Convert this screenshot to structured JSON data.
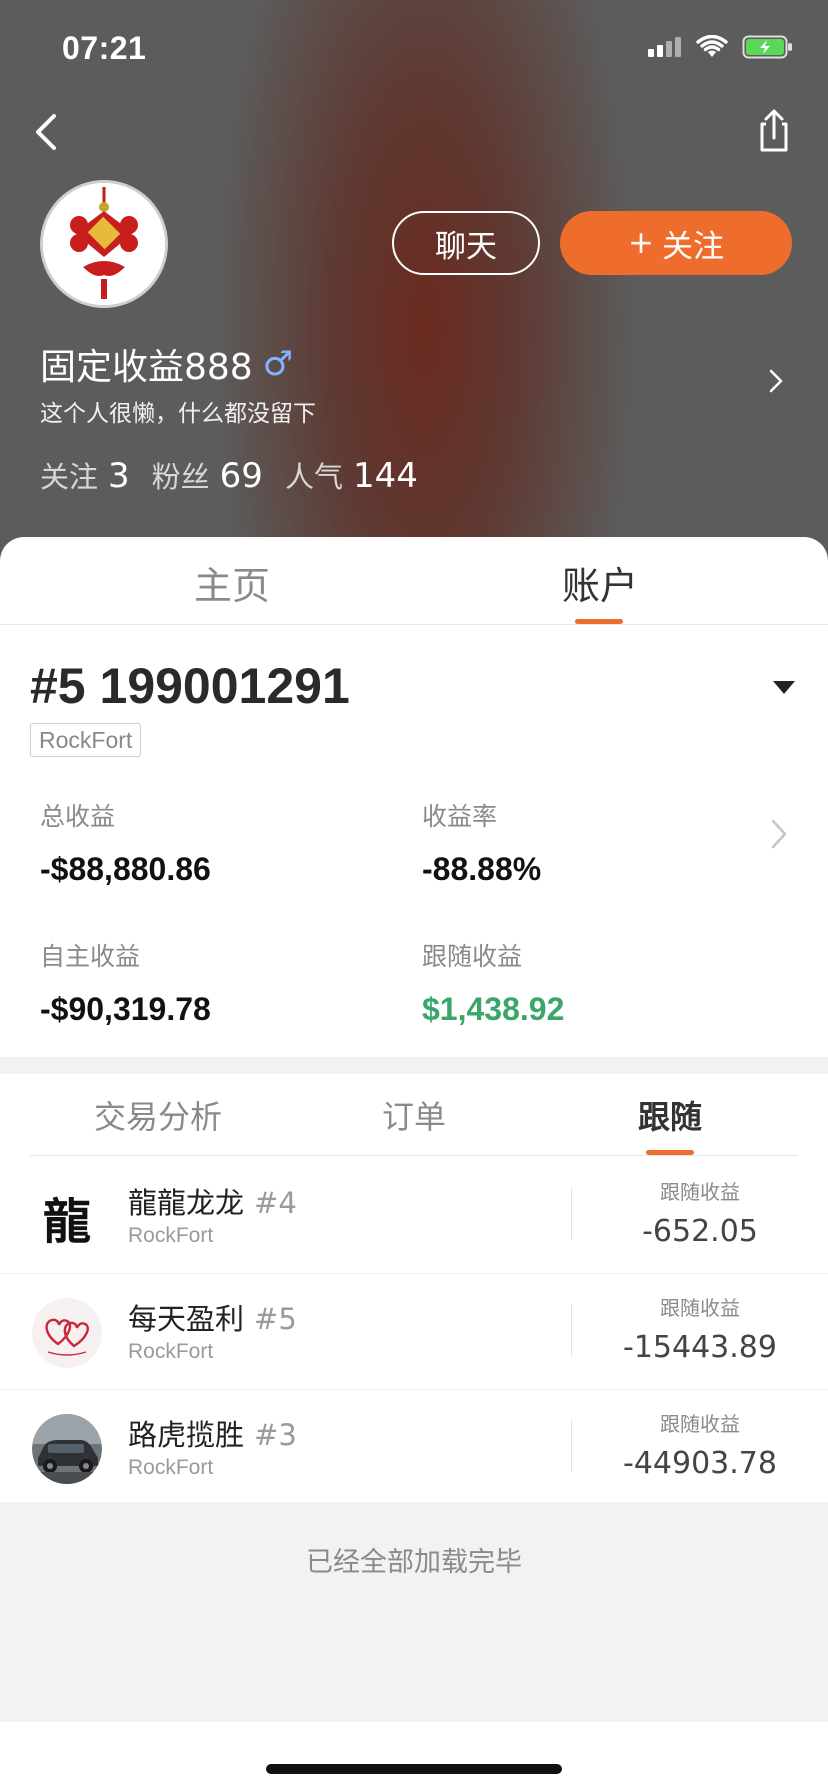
{
  "status_bar": {
    "time": "07:21"
  },
  "profile": {
    "chat_label": "聊天",
    "follow_label": "关注",
    "follow_plus": "+",
    "username": "固定收益888",
    "gender_symbol": "♂",
    "bio": "这个人很懒，什么都没留下",
    "stats": [
      {
        "label": "关注",
        "value": "3"
      },
      {
        "label": "粉丝",
        "value": "69"
      },
      {
        "label": "人气",
        "value": "144"
      }
    ]
  },
  "top_tabs": [
    {
      "label": "主页",
      "active": false
    },
    {
      "label": "账户",
      "active": true
    }
  ],
  "account": {
    "number": "#5 199001291",
    "broker": "RockFort",
    "metrics": [
      {
        "label": "总收益",
        "value": "-$88,880.86",
        "color": "#111111"
      },
      {
        "label": "收益率",
        "value": "-88.88%",
        "color": "#111111"
      },
      {
        "label": "自主收益",
        "value": "-$90,319.78",
        "color": "#111111"
      },
      {
        "label": "跟随收益",
        "value": "$1,438.92",
        "color": "#3ba66a"
      }
    ]
  },
  "sub_tabs": [
    {
      "label": "交易分析",
      "active": false
    },
    {
      "label": "订单",
      "active": false
    },
    {
      "label": "跟随",
      "active": true
    }
  ],
  "follow_list": [
    {
      "name": "龍龍龙龙",
      "rank": "#4",
      "broker": "RockFort",
      "income_label": "跟随收益",
      "income": "-652.05",
      "avatar_text": "龍"
    },
    {
      "name": "每天盈利",
      "rank": "#5",
      "broker": "RockFort",
      "income_label": "跟随收益",
      "income": "-15443.89"
    },
    {
      "name": "路虎揽胜",
      "rank": "#3",
      "broker": "RockFort",
      "income_label": "跟随收益",
      "income": "-44903.78"
    }
  ],
  "end_text": "已经全部加载完毕",
  "colors": {
    "accent": "#ef6d2c",
    "positive": "#3ba66a"
  }
}
